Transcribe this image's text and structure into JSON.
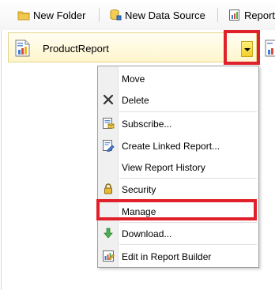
{
  "toolbar": {
    "new_folder": "New Folder",
    "new_data_source": "New Data Source",
    "report_builder": "Report"
  },
  "item": {
    "name": "ProductReport"
  },
  "context_menu": {
    "items": [
      {
        "label": "Move",
        "icon": "none"
      },
      {
        "label": "Delete",
        "icon": "delete-x-icon"
      },
      {
        "label": "Subscribe...",
        "icon": "subscribe-icon"
      },
      {
        "label": "Create Linked Report...",
        "icon": "linked-report-icon"
      },
      {
        "label": "View Report History",
        "icon": "none"
      },
      {
        "label": "Security",
        "icon": "lock-icon"
      },
      {
        "label": "Manage",
        "icon": "none"
      },
      {
        "label": "Download...",
        "icon": "download-icon"
      },
      {
        "label": "Edit in Report Builder",
        "icon": "report-builder-icon"
      }
    ]
  },
  "colors": {
    "highlight": "#e0202a",
    "item_bg": "#fff6cc",
    "dropdown": "#f2cf2a"
  }
}
